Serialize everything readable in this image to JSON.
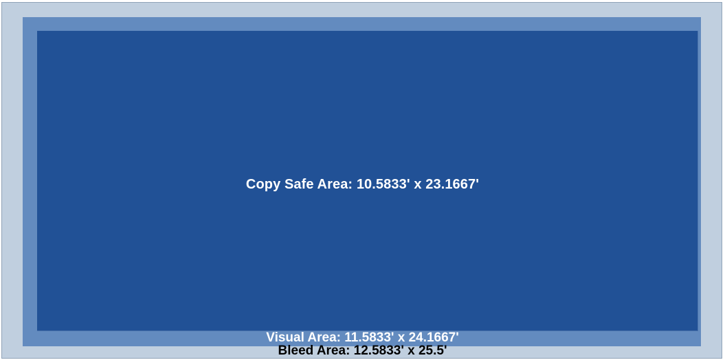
{
  "areas": {
    "bleed": {
      "label": "Bleed Area: 12.5833' x 25.5'",
      "color": "#c0cfdf",
      "label_color": "#000000"
    },
    "visual": {
      "label": "Visual Area: 11.5833' x 24.1667'",
      "color": "#638bbf",
      "label_color": "#ffffff"
    },
    "copy_safe": {
      "label": "Copy Safe Area: 10.5833' x 23.1667'",
      "color": "#215196",
      "label_color": "#ffffff"
    }
  }
}
